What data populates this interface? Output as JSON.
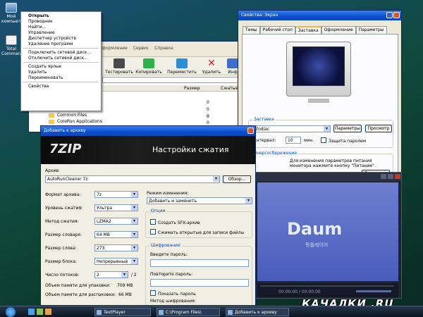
{
  "desktop": {
    "icons": [
      {
        "label": "Мой компьютер"
      },
      {
        "label": "Total Commander"
      }
    ],
    "watermark": "КАЧАЛКИ .RU"
  },
  "context_menu": {
    "groups": [
      [
        "Открыть",
        "Проводник",
        "Найти...",
        "Управление",
        "Диспетчер устройств",
        "Удаление программ"
      ],
      [
        "Подключить сетевой диск...",
        "Отключить сетевой диск..."
      ],
      [
        "Создать ярлык",
        "Удалить",
        "Переименовать"
      ],
      [
        "Свойства"
      ]
    ]
  },
  "explorer": {
    "menu": [
      "оформление",
      "Сервис",
      "Справка"
    ],
    "toolbar": [
      "Тестировать",
      "Копировать",
      "Переместить",
      "Удалить",
      "Инф"
    ],
    "columns": [
      "Размер",
      "Сжатый"
    ],
    "rows": [
      {
        "name": "",
        "size": "0"
      },
      {
        "name": "",
        "size": "0"
      },
      {
        "name": "",
        "size": "0"
      },
      {
        "name": "Common Files",
        "size": "0"
      },
      {
        "name": "CoreRun Applications",
        "size": "0"
      }
    ]
  },
  "display": {
    "title": "Свойства: Экран",
    "tabs": [
      "Темы",
      "Рабочий стол",
      "Заставка",
      "Оформление",
      "Параметры"
    ],
    "active_tab": 2,
    "screensaver_group": "Заставка",
    "screensaver_value": "Zodiac",
    "params_button": "Параметры",
    "preview_button": "Просмотр",
    "interval_label": "Интервал:",
    "interval_value": "10",
    "interval_unit": "мин.",
    "password_check": "Защита паролем",
    "power_group": "Энергосбережение",
    "power_text": "Для изменения параметров питания монитора нажмите кнопку \"Питание\".",
    "power_button": "Питание..."
  },
  "player": {
    "logo": "Daum",
    "sub": "팟플레이어",
    "time": "00:00:00 / 00:00:00"
  },
  "zip": {
    "title": "Добавить к архиву",
    "logo": "7ZIP",
    "header": "Настройки сжатия",
    "archive_label": "Архив:",
    "archive_value": "AutoRunCleaner 7z",
    "browse_button": "Обзор...",
    "labels": [
      "Формат архива:",
      "Уровень сжатия:",
      "Метод сжатия:",
      "Размер словаря:",
      "Размер слова:",
      "Размер блока:",
      "Число потоков:"
    ],
    "values": [
      "7z",
      "Ультра",
      "LZMA2",
      "64 MB",
      "273",
      "Непрерывный",
      "2"
    ],
    "threads_total": "/ 2",
    "mem_pack_label": "Объем памяти для упаковки:",
    "mem_pack_value": "709 MB",
    "mem_unpack_label": "Объем памяти для распаковки:",
    "mem_unpack_value": "66 MB",
    "update_label": "Режим изменения:",
    "update_value": "Добавить и заменить",
    "options_group": "Опции",
    "sfx_check": "Создать SFX-архив",
    "shared_check": "Сжимать открытые для записи файлы",
    "encrypt_group": "Шифрование",
    "password_label": "Введите пароль:",
    "repeat_label": "Повторите пароль:",
    "show_password": "Показать пароль",
    "method_label": "Метод шифрования:"
  },
  "taskbar": {
    "items": [
      "TextPlayer",
      "C:\\Program Files\\",
      "Добавить к архиву"
    ]
  }
}
